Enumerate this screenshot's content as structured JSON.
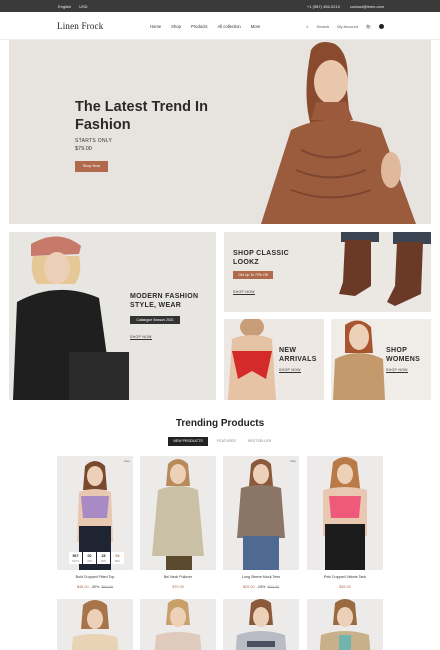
{
  "topbar": {
    "language": "English",
    "currency": "USD",
    "phone": "+1 (987) 456-0210",
    "email": "contact@linen.com"
  },
  "header": {
    "logo": "Linen Frock",
    "nav": [
      "Home",
      "Shop",
      "Products",
      "All collection",
      "More"
    ],
    "search": "Search",
    "account": "My Account"
  },
  "hero": {
    "title": "The Latest Trend In Fashion",
    "starts_only": "STARTS ONLY",
    "price": "$79.00",
    "button": "Shop Now"
  },
  "banners": {
    "modern": {
      "title": "MODERN FASHION STYLE, WEAR",
      "tag": "Catalogue Season 2021",
      "link": "SHOP NOW"
    },
    "classic": {
      "title": "SHOP CLASSIC LOOKZ",
      "tag": "Get Up To 70% Off",
      "link": "SHOP NOW"
    },
    "arrivals": {
      "title": "NEW ARRIVALS",
      "link": "SHOP NOW"
    },
    "womens": {
      "title": "SHOP WOMENS",
      "link": "SHOP NOW"
    }
  },
  "trending": {
    "title": "Trending Products",
    "tabs": [
      "NEW PRODUCTS",
      "FEATURED",
      "BESTSELLER"
    ]
  },
  "products": [
    {
      "name": "Bold Cropped Fitted Top",
      "price": "$46.00",
      "off": "-30%",
      "old": "$65.00",
      "sale": "Sale"
    },
    {
      "name": "Bel Neck Pullover",
      "price": "$79.00",
      "off": "",
      "old": "",
      "sale": ""
    },
    {
      "name": "Long Sleeve Mock Tees",
      "price": "$25.00",
      "off": "-15%",
      "old": "$30.00",
      "sale": "Sale"
    },
    {
      "name": "Pink Cropped Vittorie Tank",
      "price": "$35.00",
      "off": "",
      "old": "",
      "sale": ""
    }
  ],
  "countdown": [
    {
      "value": "567",
      "unit": "DAYS"
    },
    {
      "value": "00",
      "unit": "HRS"
    },
    {
      "value": "28",
      "unit": "MIN"
    },
    {
      "value": "04",
      "unit": "SEC"
    }
  ],
  "colors": {
    "accent": "#b06a4b",
    "dark": "#222222",
    "topbar": "#3a3a3a"
  }
}
